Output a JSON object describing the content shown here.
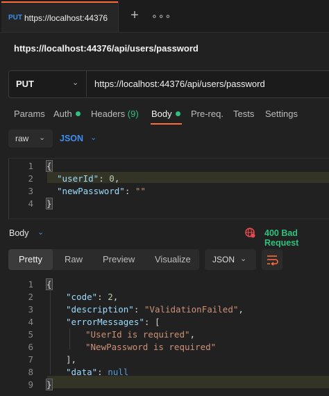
{
  "tab": {
    "method": "PUT",
    "title": "https://localhost:44376"
  },
  "request": {
    "title": "https://localhost:44376/api/users/password",
    "method": "PUT",
    "url": "https://localhost:44376/api/users/password"
  },
  "request_tabs": {
    "params": "Params",
    "auth": "Auth",
    "headers": "Headers",
    "headers_count": "(9)",
    "body": "Body",
    "prereq": "Pre-req.",
    "tests": "Tests",
    "settings": "Settings"
  },
  "body_mode": {
    "raw": "raw",
    "format": "JSON"
  },
  "request_body": {
    "line_numbers": [
      "1",
      "2",
      "3",
      "4"
    ],
    "open_brace": "{",
    "key_userId": "\"userId\"",
    "val_userId": "0",
    "key_newPassword": "\"newPassword\"",
    "val_newPassword": "\"\"",
    "close_brace": "}"
  },
  "response": {
    "body_label": "Body",
    "status": "400 Bad Request",
    "views": {
      "pretty": "Pretty",
      "raw": "Raw",
      "preview": "Preview",
      "visualize": "Visualize"
    },
    "format": "JSON",
    "line_numbers": [
      "1",
      "2",
      "3",
      "4",
      "5",
      "6",
      "7",
      "8",
      "9"
    ],
    "open_brace": "{",
    "key_code": "\"code\"",
    "val_code": "2",
    "key_description": "\"description\"",
    "val_description": "\"ValidationFailed\"",
    "key_errorMessages": "\"errorMessages\"",
    "open_bracket": "[",
    "msg1": "\"UserId is required\"",
    "msg2": "\"NewPassword is required\"",
    "close_bracket": "],",
    "key_data": "\"data\"",
    "val_data": "null",
    "close_brace": "}"
  },
  "colors": {
    "accent": "#ff6c37",
    "link": "#3c8ff0",
    "success_dot": "#2ec27e",
    "error": "#e5484d"
  }
}
